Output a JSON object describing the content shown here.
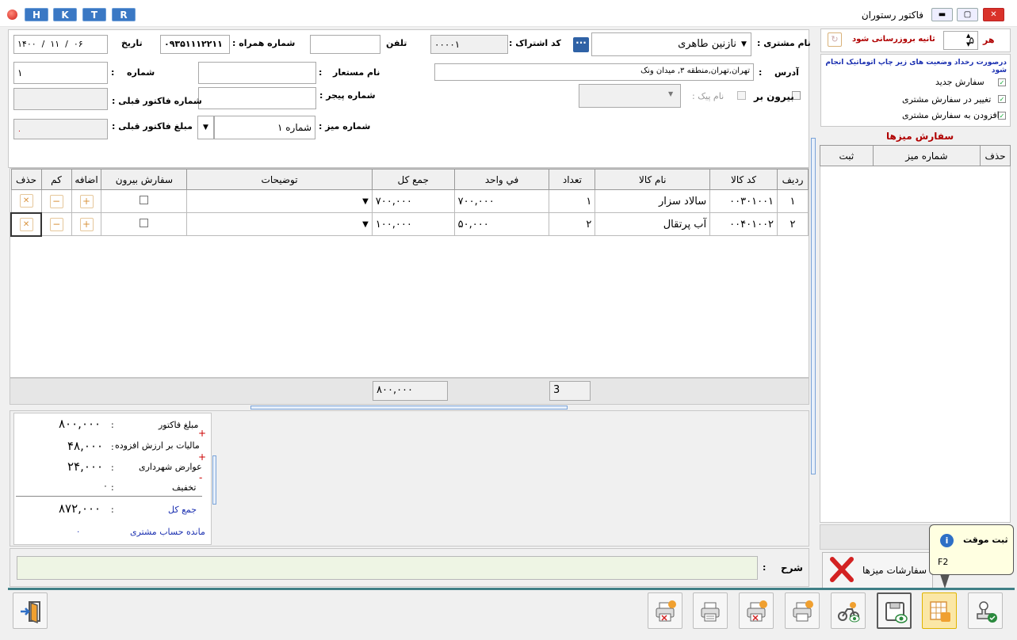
{
  "window": {
    "title": "فاکتور رستوران",
    "quick_buttons": [
      "H",
      "K",
      "T",
      "R"
    ]
  },
  "header": {
    "customer_name_label": "نام مشتری :",
    "customer_name_value": "نازنین طاهری",
    "subscription_code_label": "کد اشتراک :",
    "subscription_code_value": "۰۰۰۰۱",
    "phone_label": "تلفن",
    "phone_value": "",
    "mobile_label": "شماره همراه :",
    "mobile_value": "۰۹۳۵۱۱۱۲۲۱۱",
    "date_label": "تاریخ",
    "date_value": "۱۴۰۰  /  ۱۱  /  ۰۶",
    "address_label": "آدرس",
    "address_value": "تهران,تهران,منطقه ۳, میدان ونک",
    "alias_label": "نام مستعار",
    "number_label": "شماره",
    "number_value": "۱",
    "takeout_label": "بیرون بر",
    "courier_label": "نام پیک :",
    "pager_label": "شماره پیجر :",
    "prev_invoice_number_label": "شماره فاکتور قبلی :",
    "prev_invoice_amount_label": "مبلغ فاکتور قبلی :",
    "prev_invoice_amount_value": "۰",
    "table_number_label": "شماره میز :",
    "table_number_value": "شماره ۱"
  },
  "items_table": {
    "columns": [
      "ردیف",
      "کد کالا",
      "نام کالا",
      "تعداد",
      "في واحد",
      "جمع کل",
      "توضیحات",
      "سفارش بیرون",
      "اضافه",
      "کم",
      "حذف"
    ],
    "rows": [
      {
        "row": "۱",
        "code": "۰۰۳۰۱۰۰۱",
        "name": "سالاد سزار",
        "qty": "۱",
        "unit": "۷۰۰,۰۰۰",
        "total": "۷۰۰,۰۰۰"
      },
      {
        "row": "۲",
        "code": "۰۰۴۰۱۰۰۲",
        "name": "آب پرتقال",
        "qty": "۲",
        "unit": "۵۰,۰۰۰",
        "total": "۱۰۰,۰۰۰"
      }
    ],
    "footer_qty": "3",
    "footer_total": "۸۰۰,۰۰۰"
  },
  "summary": {
    "invoice_amount_label": "مبلغ فاکتور",
    "invoice_amount": "۸۰۰,۰۰۰",
    "vat_label": "مالیات بر ارزش افزوده",
    "vat": "۴۸,۰۰۰",
    "municipal_label": "عوارض شهرداری",
    "municipal": "۲۴,۰۰۰",
    "discount_label": "تخفیف",
    "discount": "۰",
    "total_label": "جمع کل",
    "total": "۸۷۲,۰۰۰",
    "balance_label": "مانده حساب مشتری",
    "balance": "۰"
  },
  "notes": {
    "label": "شرح"
  },
  "right_panel": {
    "every_label": "هر",
    "refresh_value": "۵",
    "refresh_label": "ثانیه بروزرسانی شود",
    "auto_print_label": "درصورت رخداد وضعیت های زیر چاپ اتوماتیک انجام شود",
    "opt_new": "سفارش جدید",
    "opt_change": "تغییر در سفارش مشتری",
    "opt_add": "افزودن به سفارش مشتری",
    "table_orders_title": "سفارش میزها",
    "table_orders_columns": [
      "حذف",
      "شماره میز",
      "ثبت"
    ],
    "table_orders_button": "سفارشات میزها"
  },
  "tooltip": {
    "title": "ثبت موقت",
    "shortcut": "F2"
  },
  "colors": {
    "accent": "#3a78c4",
    "red": "#cc0000",
    "border": "#a9a9a9"
  }
}
